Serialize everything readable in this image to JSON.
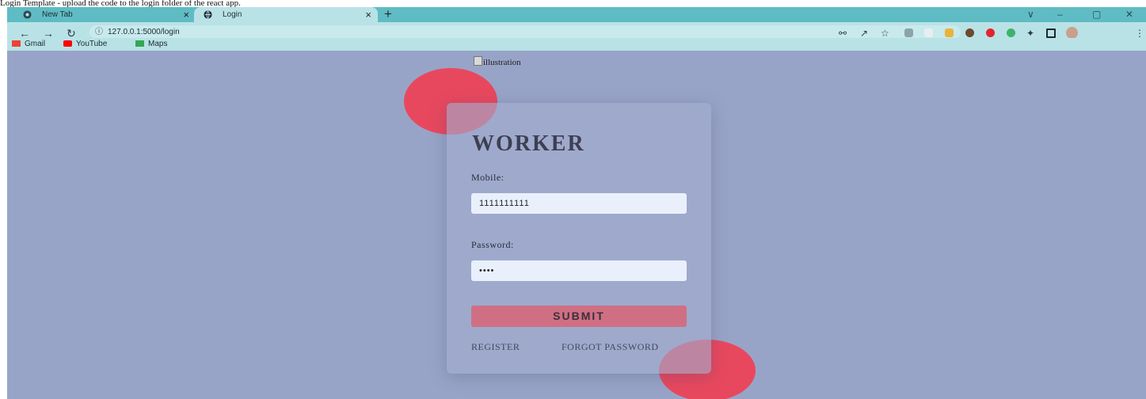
{
  "caption": "Login Template - upload the code to the login folder of the react app.",
  "browser": {
    "tabs": [
      {
        "title": "New Tab",
        "active": false
      },
      {
        "title": "Login",
        "active": true
      }
    ],
    "new_tab_symbol": "+",
    "close_symbol": "×",
    "window_controls": [
      "∨",
      "–",
      "▢",
      "✕"
    ],
    "url": "127.0.0.1:5000/login",
    "bookmarks": [
      {
        "label": "Gmail",
        "icon": "gmail-icon",
        "color": "#ea4335"
      },
      {
        "label": "YouTube",
        "icon": "youtube-icon",
        "color": "#ff0000"
      },
      {
        "label": "Maps",
        "icon": "maps-icon",
        "color": "#34a853"
      }
    ]
  },
  "page": {
    "illustration_alt": "illustration",
    "title": "WORKER",
    "mobile_label": "Mobile:",
    "mobile_value": "1111111111",
    "password_label": "Password:",
    "password_value": "••••",
    "submit_label": "SUBMIT",
    "register_label": "REGISTER",
    "forgot_label": "FORGOT PASSWORD"
  },
  "colors": {
    "tab_bar": "#5fbcc4",
    "toolbar": "#b9e2e6",
    "background": "#98a4c7",
    "accent_circle": "#e8485e",
    "submit": "#d06f83",
    "input": "#e9f0fc"
  }
}
